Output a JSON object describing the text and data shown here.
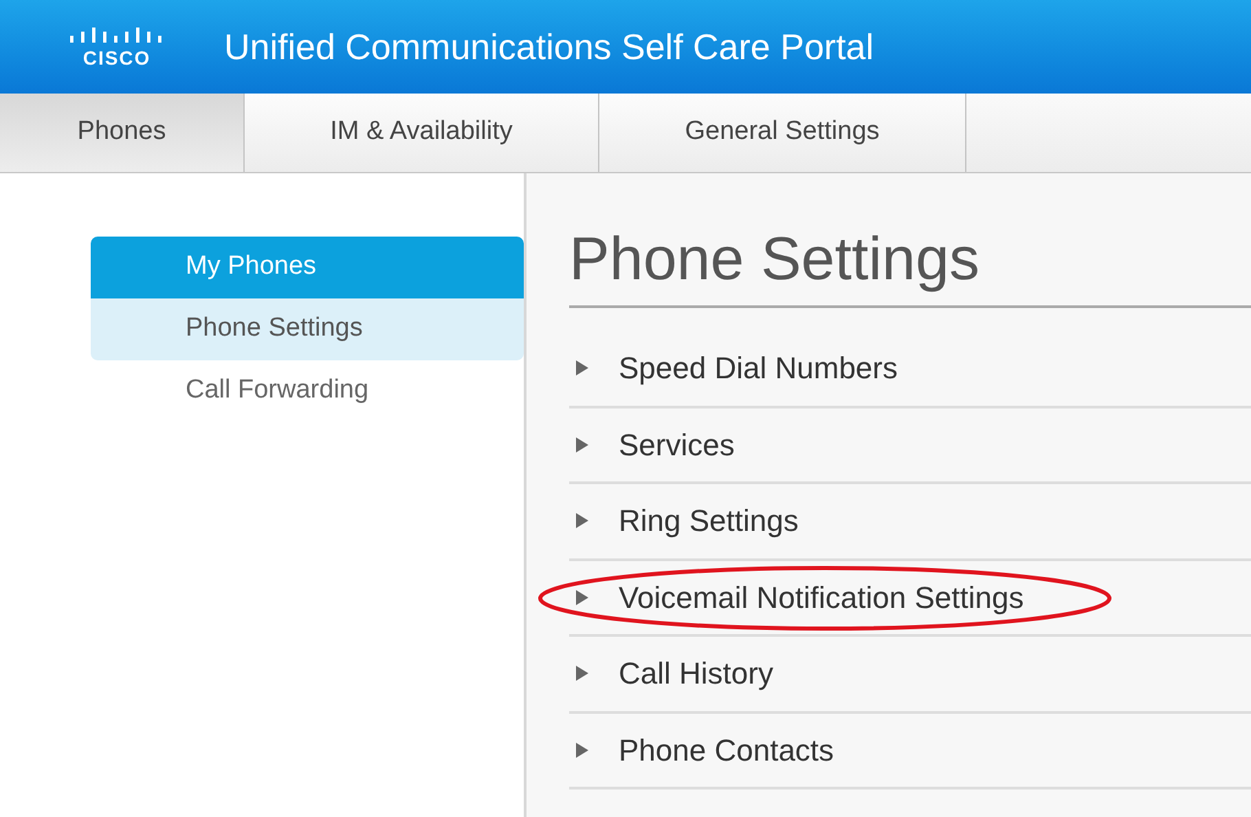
{
  "header": {
    "logo_text": "CISCO",
    "title": "Unified Communications Self Care Portal"
  },
  "tabs": [
    {
      "label": "Phones",
      "selected": true
    },
    {
      "label": "IM & Availability",
      "selected": false
    },
    {
      "label": "General Settings",
      "selected": false
    }
  ],
  "sidebar": {
    "items": [
      {
        "label": "My Phones",
        "selected": true,
        "highlighted": false
      },
      {
        "label": "Phone Settings",
        "selected": false,
        "highlighted": true
      },
      {
        "label": "Call Forwarding",
        "selected": false,
        "highlighted": false
      }
    ]
  },
  "main": {
    "heading": "Phone Settings",
    "sections": [
      {
        "label": "Speed Dial Numbers",
        "expanded": false,
        "circled": false
      },
      {
        "label": "Services",
        "expanded": false,
        "circled": false
      },
      {
        "label": "Ring Settings",
        "expanded": false,
        "circled": false
      },
      {
        "label": "Voicemail Notification Settings",
        "expanded": false,
        "circled": true
      },
      {
        "label": "Call History",
        "expanded": false,
        "circled": false
      },
      {
        "label": "Phone Contacts",
        "expanded": false,
        "circled": false
      }
    ]
  }
}
